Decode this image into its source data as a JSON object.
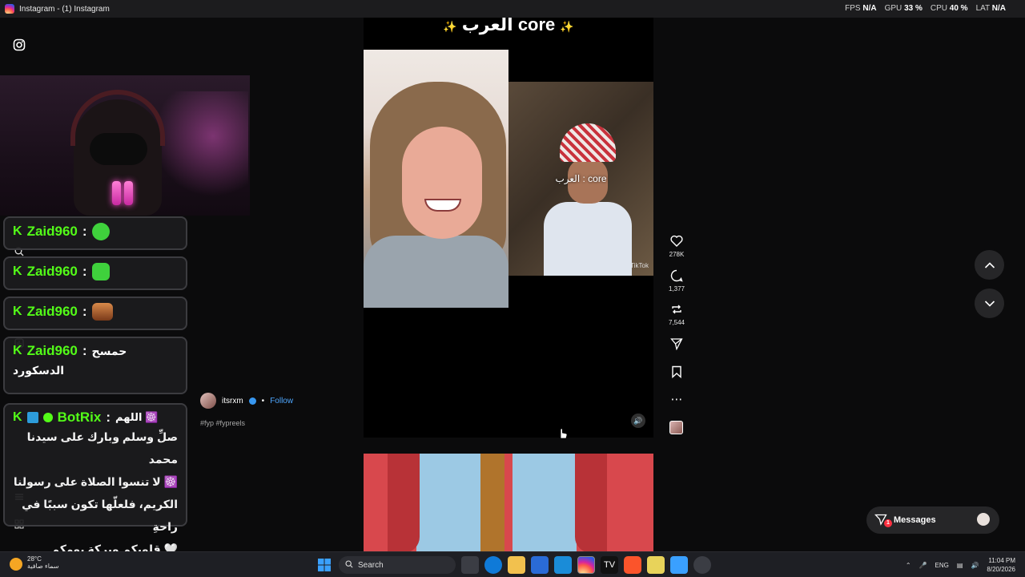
{
  "window": {
    "title": "Instagram - (1) Instagram"
  },
  "overlay_stats": {
    "fps_label": "FPS",
    "fps_value": "N/A",
    "gpu_label": "GPU",
    "gpu_value": "33 %",
    "cpu_label": "CPU",
    "cpu_value": "40 %",
    "lat_label": "LAT",
    "lat_value": "N/A"
  },
  "chat": {
    "messages": [
      {
        "user": "Zaid960",
        "sep": ":",
        "emote": "green-emoji-emote"
      },
      {
        "user": "Zaid960",
        "sep": ":",
        "emote": "green-grin-emote"
      },
      {
        "user": "Zaid960",
        "sep": ":",
        "emote": "face-emote"
      },
      {
        "user": "Zaid960",
        "sep": ":",
        "text_line1": "حمسح",
        "text_line2": "الدسكورد"
      },
      {
        "user": "BotRix",
        "sep": ":",
        "lines": [
          "اللهم ☸️",
          "صلِّ وسلم وبارك على سيدنا محمد",
          "☸️ لا تنسوا الصلاة على رسولنا",
          "الكريم، فلعلّها تكون سببًا في راحةِ",
          "🤍 قلوبكم وبركة يومكم"
        ]
      }
    ]
  },
  "reel": {
    "caption": "العرب core",
    "sparkle": "✨",
    "video_overlay_text": "العرب : core",
    "watermark": "TikTok",
    "author": "itsrxm",
    "dot": "•",
    "follow_label": "Follow",
    "tags": "#fyp #fypreels",
    "likes": "278K",
    "comments": "1,377",
    "reposts": "7,544"
  },
  "messages": {
    "label": "Messages",
    "badge": "1"
  },
  "taskbar": {
    "temperature": "28°C",
    "weather_text": "سماء صافية",
    "search_label": "Search",
    "language": "ENG",
    "time": "11:04 PM",
    "date": "8/20/2026"
  }
}
